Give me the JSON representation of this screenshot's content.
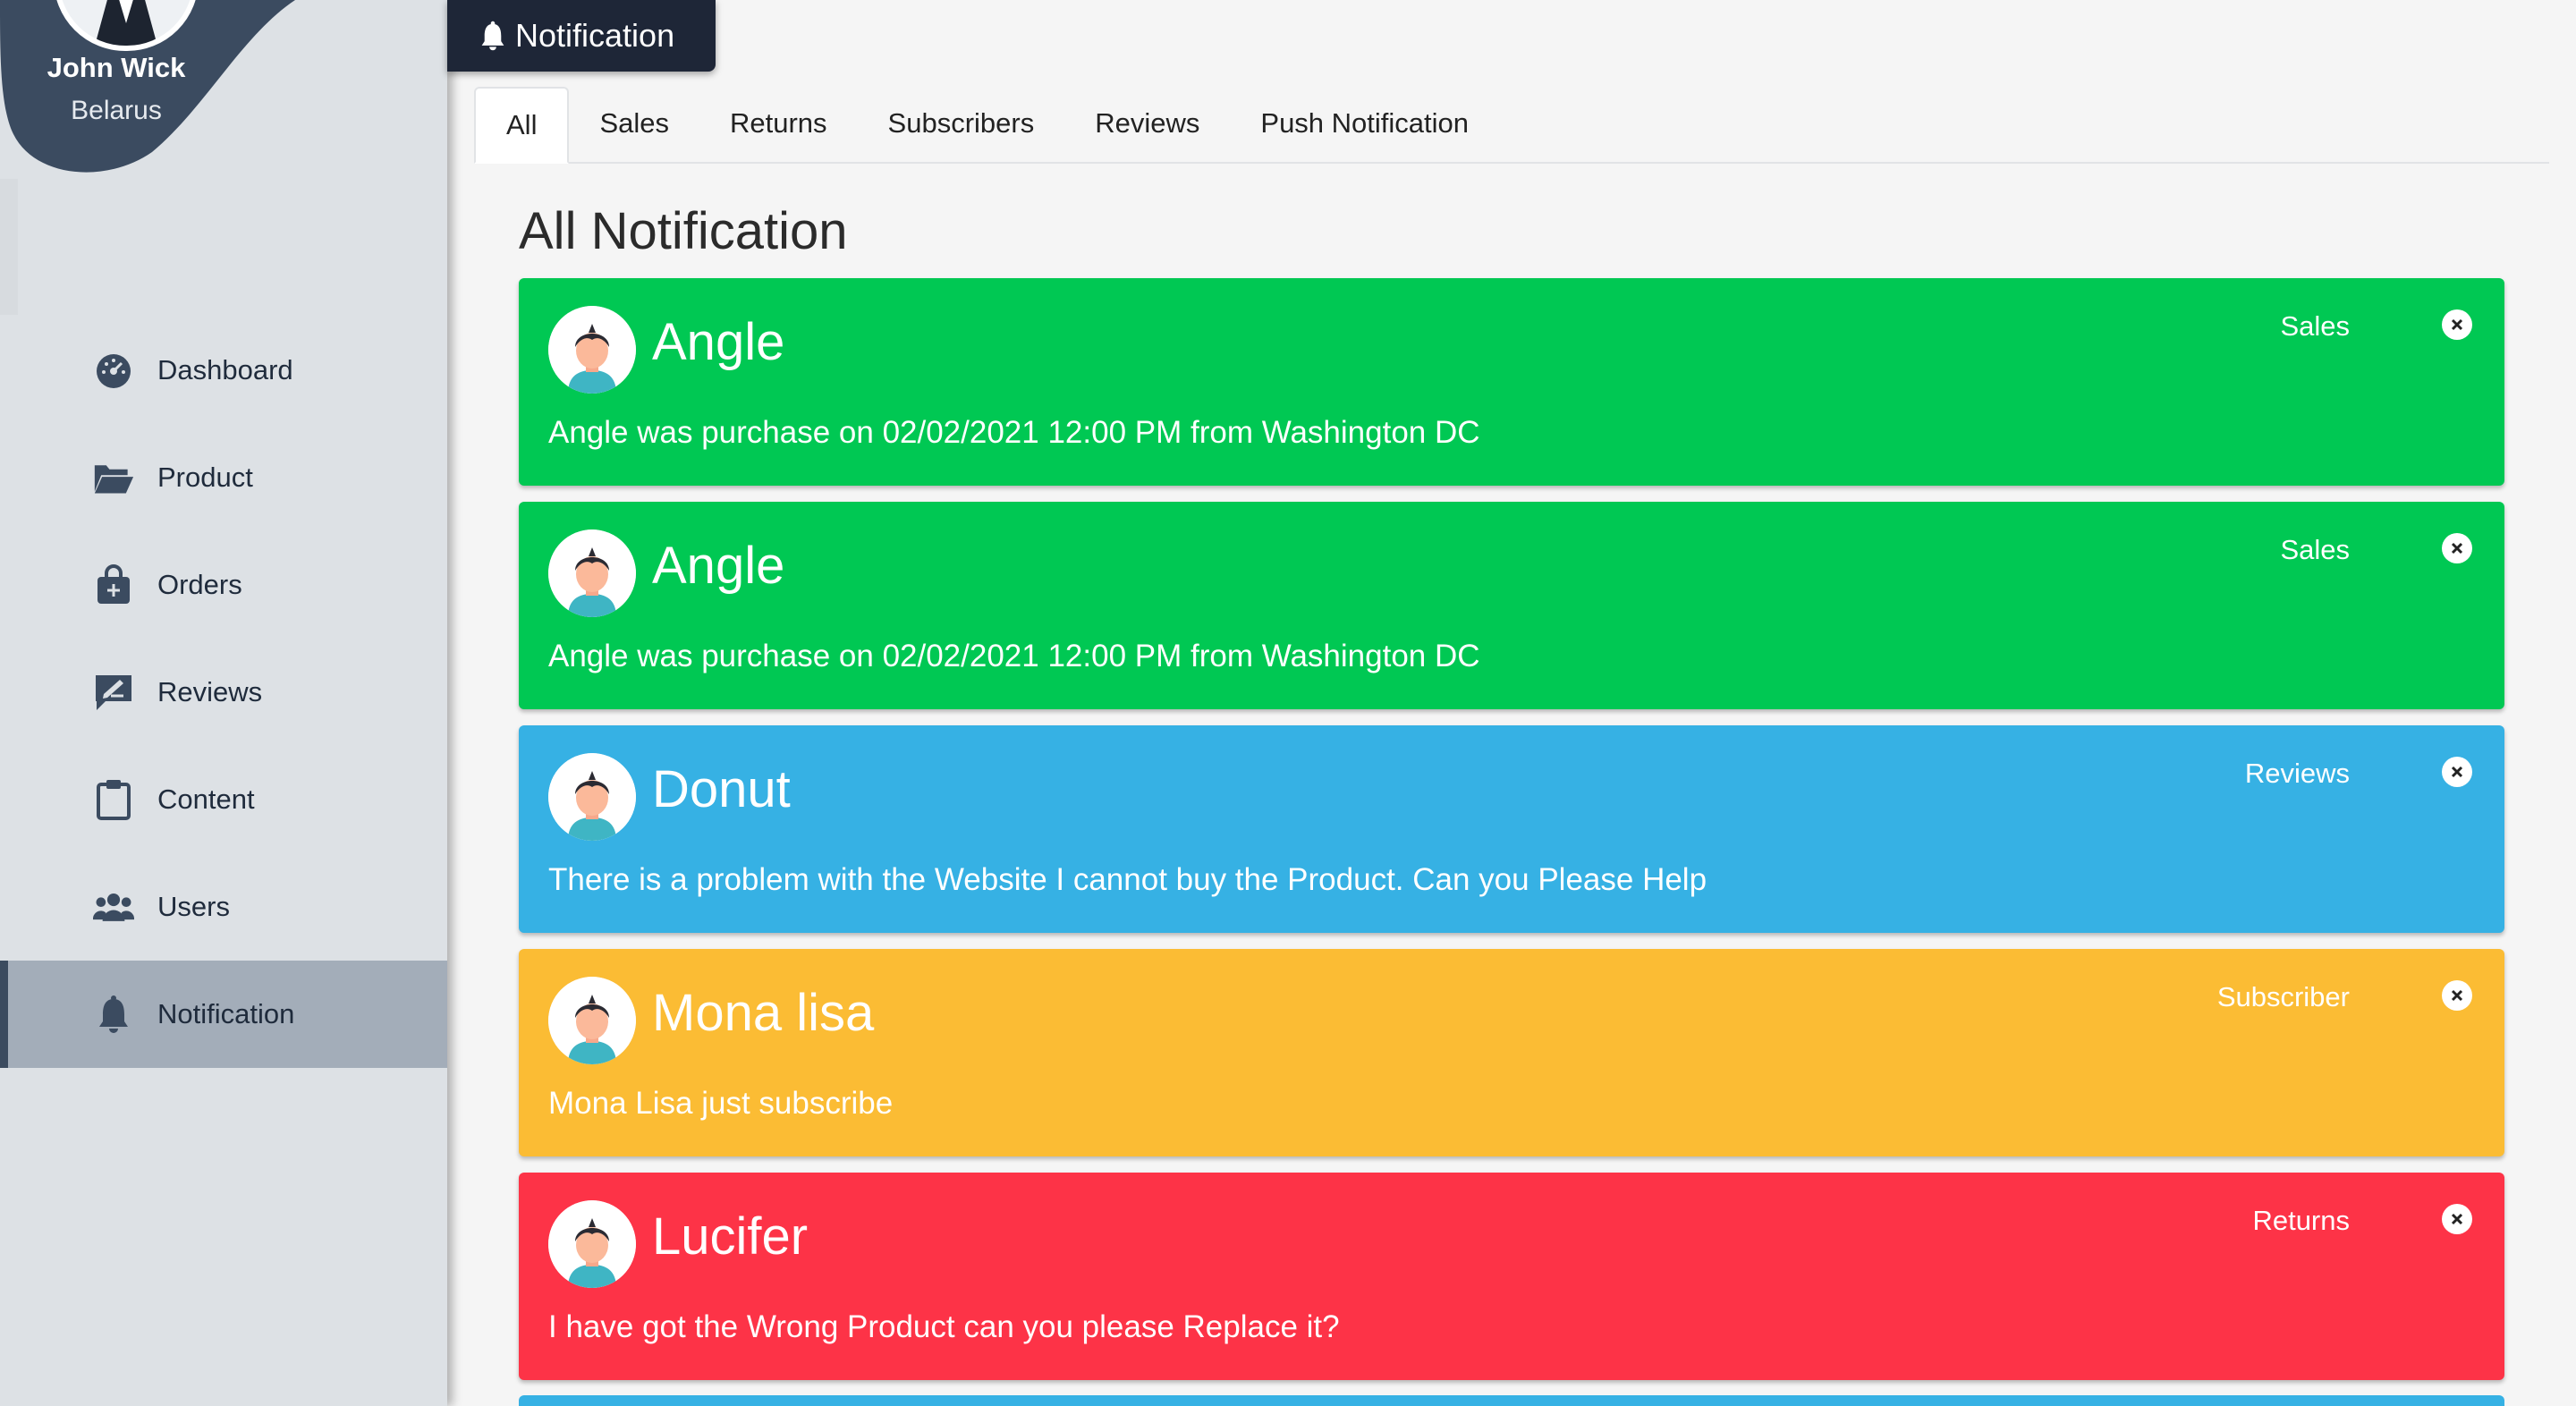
{
  "profile": {
    "name": "John Wick",
    "location": "Belarus"
  },
  "sidebar": {
    "items": [
      {
        "label": "Dashboard",
        "icon": "dashboard-icon"
      },
      {
        "label": "Product",
        "icon": "folder-open-icon"
      },
      {
        "label": "Orders",
        "icon": "shopping-bag-icon"
      },
      {
        "label": "Reviews",
        "icon": "review-edit-icon"
      },
      {
        "label": "Content",
        "icon": "clipboard-icon"
      },
      {
        "label": "Users",
        "icon": "users-icon"
      },
      {
        "label": "Notification",
        "icon": "bell-icon",
        "active": true
      }
    ]
  },
  "header": {
    "title": "Notification",
    "icon": "bell-icon"
  },
  "tabs": [
    {
      "label": "All",
      "active": true
    },
    {
      "label": "Sales"
    },
    {
      "label": "Returns"
    },
    {
      "label": "Subscribers"
    },
    {
      "label": "Reviews"
    },
    {
      "label": "Push Notification"
    }
  ],
  "main": {
    "title": "All Notification",
    "notifications": [
      {
        "name": "Angle",
        "message": "Angle was purchase on 02/02/2021 12:00 PM from Washington DC",
        "category": "Sales",
        "color": "#00c853"
      },
      {
        "name": "Angle",
        "message": "Angle was purchase on 02/02/2021 12:00 PM from Washington DC",
        "category": "Sales",
        "color": "#00c853"
      },
      {
        "name": "Donut",
        "message": "There is a problem with the Website I cannot buy the Product. Can you Please Help",
        "category": "Reviews",
        "color": "#36b1e4"
      },
      {
        "name": "Mona lisa",
        "message": "Mona Lisa just subscribe",
        "category": "Subscriber",
        "color": "#fbbc34"
      },
      {
        "name": "Lucifer",
        "message": "I have got the Wrong Product can you please Replace it?",
        "category": "Returns",
        "color": "#fd3347"
      }
    ]
  },
  "colors": {
    "sidebar_bg": "#dde1e5",
    "sidebar_active": "#a3adb9",
    "profile_blob": "#3b4b60",
    "header_tab": "#1e2637"
  }
}
